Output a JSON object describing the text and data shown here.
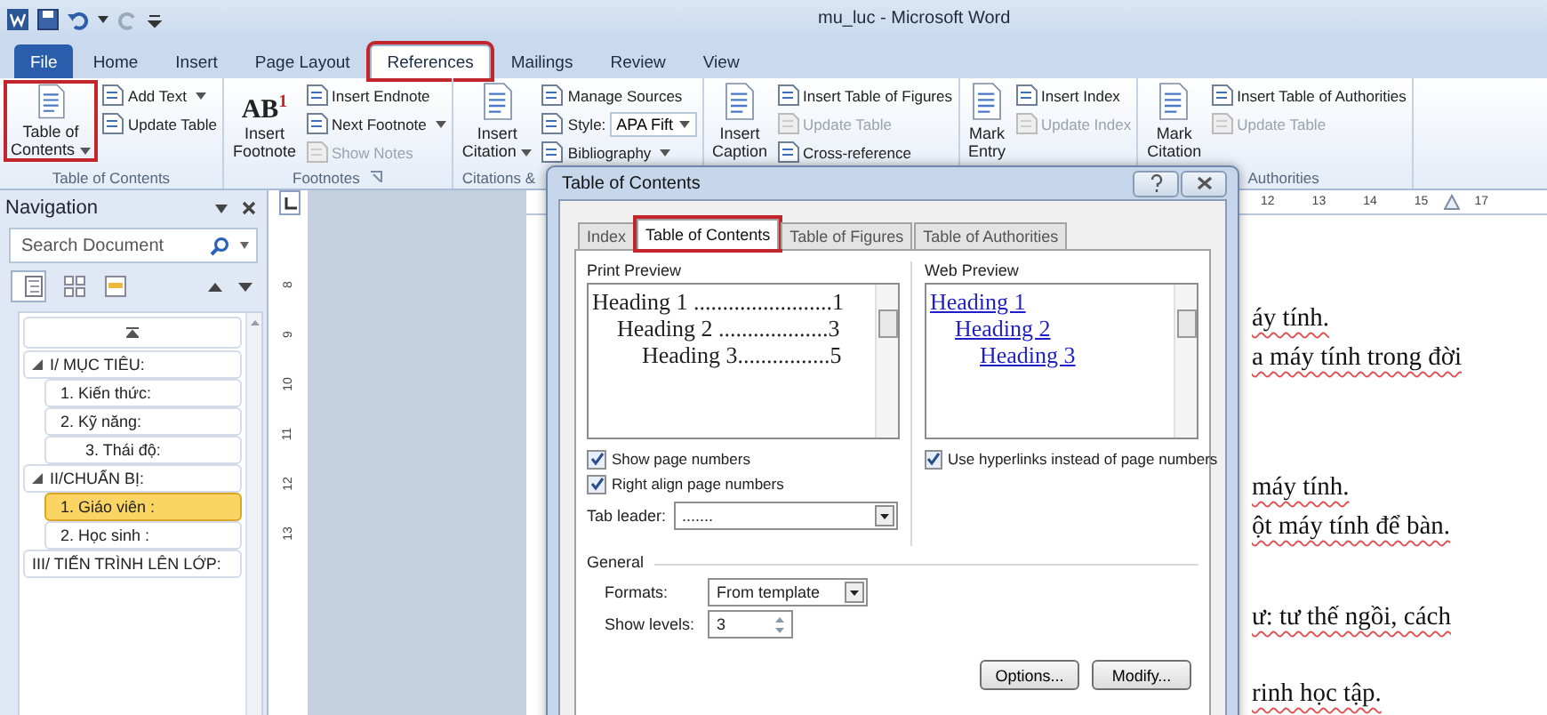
{
  "title_bar": {
    "title": "mu_luc - Microsoft Word"
  },
  "ribbon_tabs": [
    {
      "label": "File",
      "kind": "file",
      "selected": false,
      "highlighted": false
    },
    {
      "label": "Home",
      "kind": "tab",
      "selected": false,
      "highlighted": false
    },
    {
      "label": "Insert",
      "kind": "tab",
      "selected": false,
      "highlighted": false
    },
    {
      "label": "Page Layout",
      "kind": "tab",
      "selected": false,
      "highlighted": false
    },
    {
      "label": "References",
      "kind": "tab",
      "selected": true,
      "highlighted": true
    },
    {
      "label": "Mailings",
      "kind": "tab",
      "selected": false,
      "highlighted": false
    },
    {
      "label": "Review",
      "kind": "tab",
      "selected": false,
      "highlighted": false
    },
    {
      "label": "View",
      "kind": "tab",
      "selected": false,
      "highlighted": false
    }
  ],
  "ribbon_groups": [
    {
      "label": "Table of Contents",
      "large": [
        {
          "lines": [
            "Table of",
            "Contents"
          ],
          "dropdown": true,
          "highlighted": true
        }
      ],
      "small": [
        {
          "kind": "button",
          "label": "Add Text",
          "dropdown": true,
          "disabled": false
        },
        {
          "kind": "button",
          "label": "Update Table",
          "disabled": false
        }
      ]
    },
    {
      "label": "Footnotes",
      "launcher": true,
      "large": [
        {
          "lines": [
            "Insert",
            "Footnote"
          ],
          "glyph": "AB$^{1}$",
          "highlighted": false
        }
      ],
      "small": [
        {
          "kind": "button",
          "label": "Insert Endnote",
          "disabled": false
        },
        {
          "kind": "button",
          "label": "Next Footnote",
          "dropdown": true,
          "disabled": false
        },
        {
          "kind": "button",
          "label": "Show Notes",
          "disabled": true
        }
      ]
    },
    {
      "label": "Citations &",
      "large": [
        {
          "lines": [
            "Insert",
            "Citation"
          ],
          "dropdown": true,
          "highlighted": false
        }
      ],
      "small": [
        {
          "kind": "button",
          "label": "Manage Sources",
          "disabled": false
        },
        {
          "kind": "style",
          "label": "Style:",
          "value": "APA Fift"
        },
        {
          "kind": "button",
          "label": "Bibliography",
          "dropdown": true,
          "disabled": false
        }
      ]
    },
    {
      "large": [
        {
          "lines": [
            "Insert",
            "Caption"
          ],
          "highlighted": false
        }
      ],
      "small": [
        {
          "kind": "button",
          "label": "Insert Table of Figures",
          "disabled": false
        },
        {
          "kind": "button",
          "label": "Update Table",
          "disabled": true
        },
        {
          "kind": "button",
          "label": "Cross-reference",
          "disabled": false
        }
      ]
    },
    {
      "large": [
        {
          "lines": [
            "Mark",
            "Entry"
          ],
          "highlighted": false
        }
      ],
      "small": [
        {
          "kind": "button",
          "label": "Insert Index",
          "disabled": false
        },
        {
          "kind": "button",
          "label": "Update Index",
          "disabled": true
        }
      ]
    },
    {
      "label": "Authorities",
      "large": [
        {
          "lines": [
            "Mark",
            "Citation"
          ],
          "highlighted": false
        }
      ],
      "small": [
        {
          "kind": "button",
          "label": "Insert Table of Authorities",
          "disabled": false
        },
        {
          "kind": "button",
          "label": "Update Table",
          "disabled": true
        }
      ]
    }
  ],
  "navigation": {
    "title": "Navigation",
    "search": {
      "placeholder": "Search Document"
    },
    "view_tabs": [
      {
        "selected": true
      },
      {
        "selected": false
      },
      {
        "selected": false
      }
    ],
    "tree": [
      {
        "label": "I/ MỤC TIÊU:",
        "selected": false,
        "expanded": true,
        "children": [
          {
            "label": "1. Kiến thức:",
            "selected": false
          },
          {
            "label": "2. Kỹ năng:",
            "selected": false,
            "children": [
              {
                "label": "3. Thái độ:",
                "selected": false
              }
            ]
          }
        ]
      },
      {
        "label": "II/CHUẨN BỊ:",
        "selected": false,
        "expanded": true,
        "children": [
          {
            "label": "1. Giáo viên  :",
            "selected": true
          },
          {
            "label": "2. Học sinh :",
            "selected": false
          }
        ]
      },
      {
        "label": "III/ TIẾN TRÌNH LÊN LỚP:",
        "selected": false
      }
    ]
  },
  "vertical_ruler": [
    "8",
    "9",
    "10",
    "11",
    "12",
    "13"
  ],
  "top_ruler": {
    "numbers_before": [
      "12",
      "13",
      "14",
      "15"
    ],
    "numbers_after": [
      "17"
    ]
  },
  "document": {
    "paragraphs": [
      [
        "áy tính.",
        "a máy tính trong đời"
      ],
      [
        "máy tính.",
        "ột máy tính để bàn."
      ],
      [
        "ư: tư thế ngồi, cách"
      ],
      [
        "rinh học tập."
      ]
    ]
  },
  "dialog": {
    "title": "Table of Contents",
    "tabs": [
      {
        "label": "Index",
        "selected": false,
        "highlighted": false
      },
      {
        "label": "Table of Contents",
        "selected": true,
        "highlighted": true
      },
      {
        "label": "Table of Figures",
        "selected": false,
        "highlighted": false
      },
      {
        "label": "Table of Authorities",
        "selected": false,
        "highlighted": false
      }
    ],
    "print_preview": {
      "label": "Print Preview",
      "lines": [
        "Heading 1 ........................1",
        "Heading 2 ...................3",
        "Heading 3................5"
      ]
    },
    "web_preview": {
      "label": "Web Preview",
      "links": [
        "Heading 1",
        "Heading 2",
        "Heading 3"
      ]
    },
    "print_options": [
      {
        "label": "Show page numbers",
        "checked": true
      },
      {
        "label": "Right align page numbers",
        "checked": true
      }
    ],
    "hyperlinks": {
      "label": "Use hyperlinks instead of page numbers",
      "checked": true
    },
    "tab_leader": {
      "label": "Tab leader:",
      "value": "......."
    },
    "general": {
      "label": "General",
      "formats": {
        "label": "Formats:",
        "value": "From template"
      },
      "show_levels": {
        "label": "Show levels:",
        "value": "3"
      }
    },
    "buttons": [
      "Options...",
      "Modify..."
    ]
  }
}
